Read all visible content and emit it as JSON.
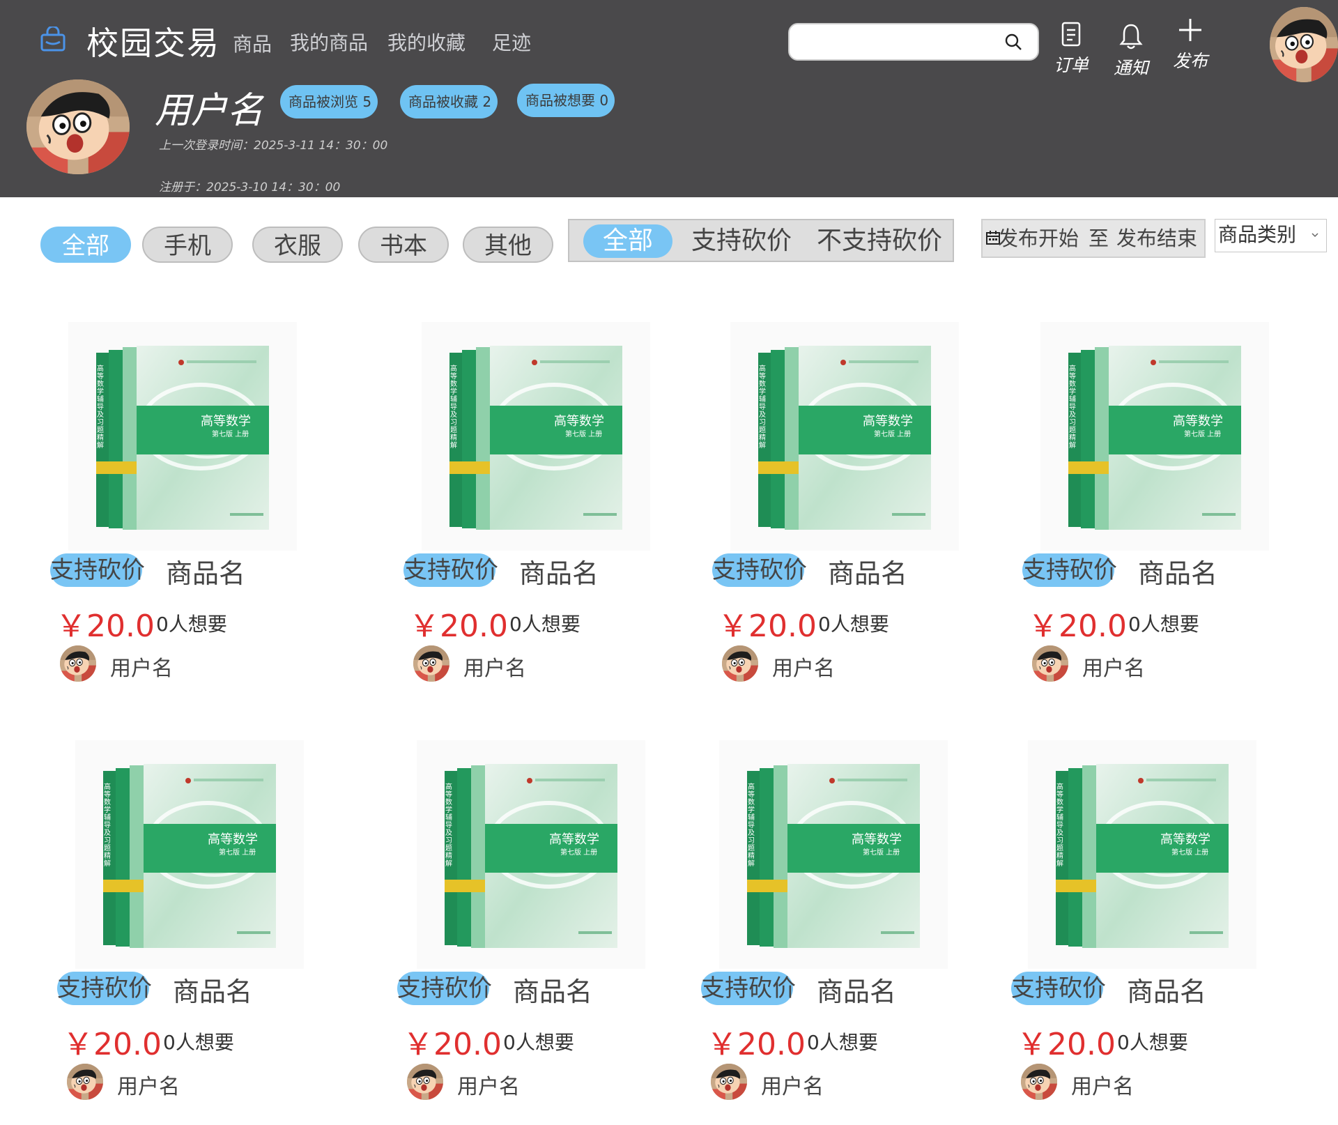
{
  "header": {
    "app_title": "校园交易",
    "nav": [
      "商品",
      "我的商品",
      "我的收藏",
      "足迹"
    ],
    "search": {
      "value": "",
      "placeholder": ""
    },
    "actions": {
      "orders": "订单",
      "notify": "通知",
      "publish": "发布"
    },
    "colors": {
      "background": "#4a494b",
      "accent": "#6fc3f3"
    }
  },
  "profile": {
    "username": "用户名",
    "stats": {
      "views": "商品被浏览 5",
      "favorites": "商品被收藏 2",
      "wants": "商品被想要 0"
    },
    "last_login": "上一次登录时间：2025-3-11  14：30：00",
    "registered": "注册于：2025-3-10 14：30：00"
  },
  "filters": {
    "categories": [
      "全部",
      "手机",
      "衣服",
      "书本",
      "其他"
    ],
    "active_category": "全部",
    "bargain_options": [
      "全部",
      "支持砍价",
      "不支持砍价"
    ],
    "active_bargain": "全部",
    "date_range": {
      "start": "发布开始",
      "sep": "至",
      "end": "发布结束"
    },
    "category_select": "商品类别"
  },
  "products": [
    {
      "tag": "支持砍价",
      "name": "商品名",
      "price": "￥20.0",
      "wants": "0人想要",
      "seller": "用户名"
    },
    {
      "tag": "支持砍价",
      "name": "商品名",
      "price": "￥20.0",
      "wants": "0人想要",
      "seller": "用户名"
    },
    {
      "tag": "支持砍价",
      "name": "商品名",
      "price": "￥20.0",
      "wants": "0人想要",
      "seller": "用户名"
    },
    {
      "tag": "支持砍价",
      "name": "商品名",
      "price": "￥20.0",
      "wants": "0人想要",
      "seller": "用户名"
    },
    {
      "tag": "支持砍价",
      "name": "商品名",
      "price": "￥20.0",
      "wants": "0人想要",
      "seller": "用户名"
    },
    {
      "tag": "支持砍价",
      "name": "商品名",
      "price": "￥20.0",
      "wants": "0人想要",
      "seller": "用户名"
    },
    {
      "tag": "支持砍价",
      "name": "商品名",
      "price": "￥20.0",
      "wants": "0人想要",
      "seller": "用户名"
    },
    {
      "tag": "支持砍价",
      "name": "商品名",
      "price": "￥20.0",
      "wants": "0人想要",
      "seller": "用户名"
    }
  ],
  "product_image": {
    "title": "高等数学",
    "edition": "第七版 上册",
    "spine": "高等数学辅导及习题精解"
  }
}
